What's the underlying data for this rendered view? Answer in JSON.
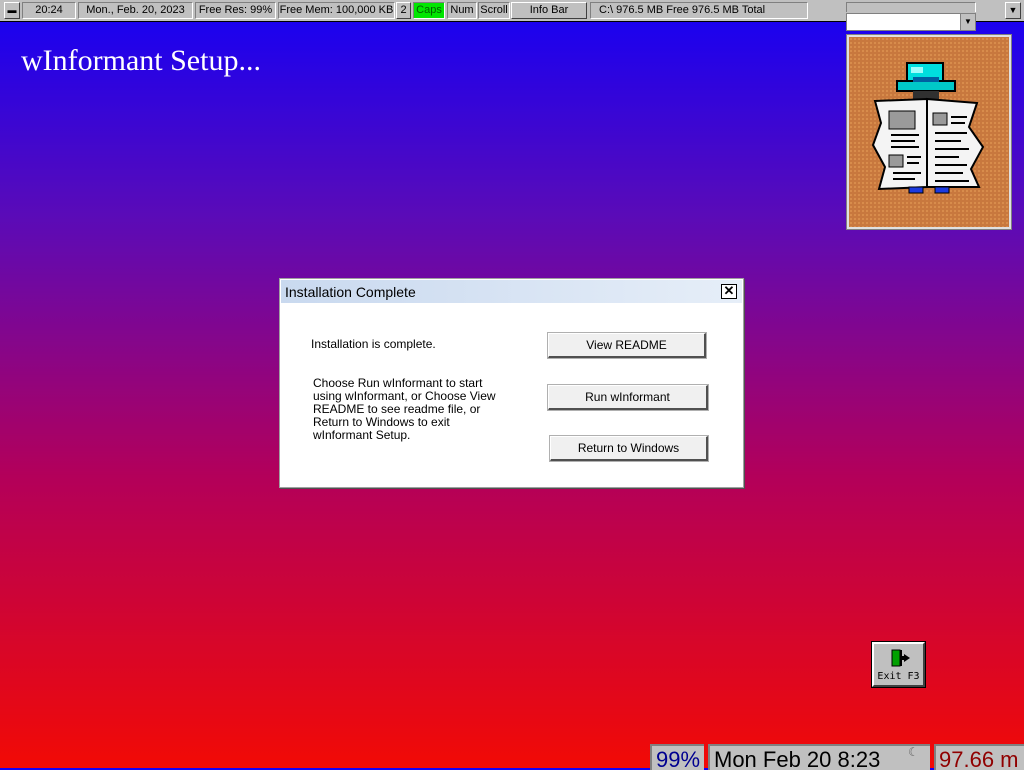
{
  "infobar": {
    "time": "20:24",
    "date": "Mon., Feb. 20, 2023",
    "free_res": "Free Res: 99%",
    "free_mem": "Free Mem: 100,000 KB",
    "desktop_num": "2",
    "caps": "Caps",
    "num": "Num",
    "scroll": "Scroll",
    "info_bar": "Info Bar",
    "disk": "C:\\ 976.5 MB Free  976.5 MB Total",
    "colors": {
      "caps_on": "#00e600",
      "bar": "#c0c0c0"
    }
  },
  "setup": {
    "title": "wInformant Setup..."
  },
  "dialog": {
    "title": "Installation Complete",
    "close_glyph": "✕",
    "message": "Installation is complete.",
    "instructions": [
      "Choose Run wInformant to start",
      "using wInformant, or Choose View",
      "README to see readme file, or",
      "Return to Windows to exit",
      "wInformant Setup."
    ],
    "buttons": {
      "view_readme": "View README",
      "run": "Run wInformant",
      "return": "Return to Windows"
    }
  },
  "exit_button": {
    "label": "Exit F3"
  },
  "bottom_status": {
    "percent": "99%",
    "datetime": "Mon Feb 20 8:23",
    "memory": "97.66 m",
    "colors": {
      "percent": "#000090",
      "memory": "#900000"
    }
  },
  "theme": {
    "gradient_top": "#1400f5",
    "gradient_bottom": "#f20a05"
  }
}
